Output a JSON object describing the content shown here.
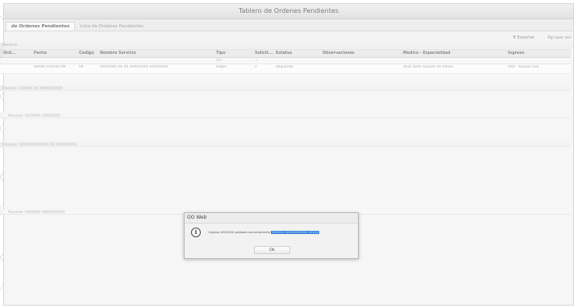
{
  "window": {
    "title": "Tablero de Ordenes Pendientes"
  },
  "tabs": [
    {
      "label": "de Ordenes Pendientes"
    },
    {
      "label": "Lista de Ordenes Pendientes"
    }
  ],
  "toolbar": {
    "export_label": "Exportar",
    "group_label": "Agrupar por"
  },
  "grid": {
    "caption": "Servicio",
    "headers": {
      "id": "Ord...",
      "fecha": "Fecha",
      "codigo": "Codigo",
      "nombre": "Nombre Servicio",
      "tipo": "Tipo",
      "solicitado": "Solicit...",
      "estado": "Estatus",
      "observaciones": "Observaciones",
      "medico": "Medico - Especialidad",
      "ingreso": "Ingreso"
    },
    "filters": {
      "tipo": "(ts)",
      "solicitado": "="
    },
    "rows": [
      {
        "top": 0,
        "id": "",
        "fecha": "00/00/ 0:00:00 PM",
        "codigo": "00",
        "nombre": "XXXXXXX XX XX XXXXXXXX XXXXXXXX",
        "tipo": "Urgen",
        "solicitado": "1",
        "estado": "Requerido",
        "medico": "Xxxx XxXx XxxxXx Xx XXxxx",
        "ingreso": "XXX - Xxxxxx Xxx"
      }
    ],
    "groups": [
      "Paciente: XXXXXX XX XXXXXXXXXX",
      "Paciente: XXXXXXX XXXXXXXX",
      "Paciente: XXXXXXXXXXXXX XX XXXXXXXXX",
      "Paciente: XXXXXXX XXXXXXXXXX"
    ]
  },
  "dialog": {
    "title": "OO Web",
    "message_prefix": "Ingreso 0000000 grabado correctamente",
    "message_selected": "XXXXXX XXXXXXXXXXX XXXXX",
    "message_suffix": "",
    "ok_label": "Ok",
    "icon": "info-icon"
  }
}
